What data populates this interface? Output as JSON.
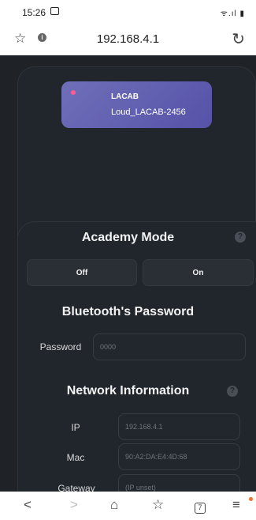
{
  "status_bar": {
    "time": "15:26",
    "signal": "ᯤ.ıl ▮"
  },
  "browser": {
    "url": "192.168.4.1",
    "tab_count": "7"
  },
  "device": {
    "name": "LACAB",
    "id": "Loud_LACAB-2456"
  },
  "academy_mode": {
    "title": "Academy Mode",
    "off_label": "Off",
    "on_label": "On"
  },
  "bluetooth": {
    "title": "Bluetooth's Password",
    "password_label": "Password",
    "password_placeholder": "0000"
  },
  "network": {
    "title": "Network Information",
    "ip_label": "IP",
    "ip_value": "192.168.4.1",
    "mac_label": "Mac",
    "mac_value": "90:A2:DA:E4:4D:68",
    "gateway_label": "Gateway",
    "gateway_value": "(IP unset)"
  },
  "colors": {
    "background": "#1f2328",
    "device_tile": "#6161b1",
    "status_dot": "#ff5c93",
    "menu_badge": "#f46f2a"
  }
}
